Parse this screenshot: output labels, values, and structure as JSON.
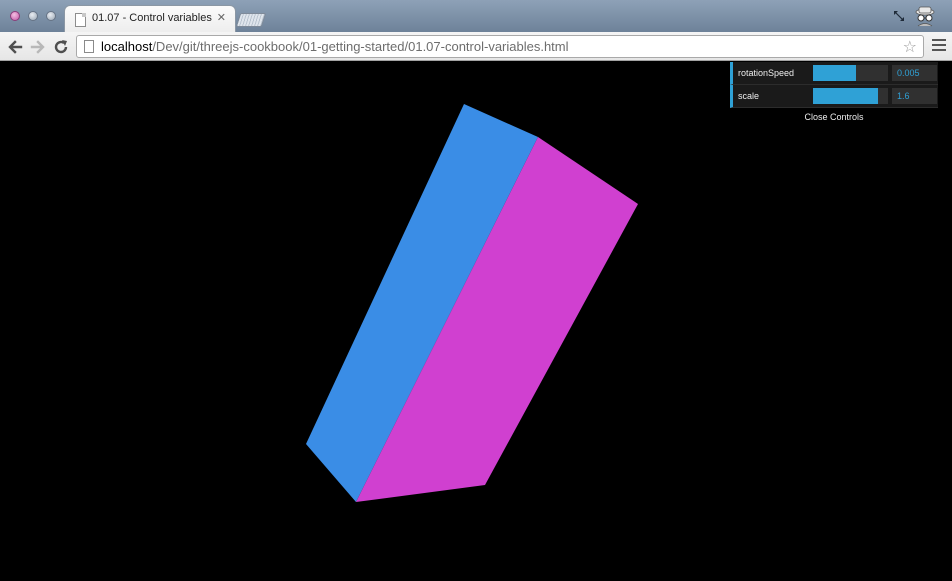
{
  "browser": {
    "tab_title": "01.07 - Control variables",
    "tab_close": "✕",
    "url_host": "localhost",
    "url_path": "/Dev/git/threejs-cookbook/01-getting-started/01.07-control-variables.html",
    "star_icon": "star-icon",
    "back_icon": "back-arrow-icon",
    "forward_icon": "forward-arrow-icon",
    "reload_icon": "reload-icon",
    "menu_icon": "hamburger-menu-icon"
  },
  "scene": {
    "background": "#000000",
    "object": "cube",
    "face_colors": {
      "left": "#3a8de6",
      "right": "#d040d0"
    }
  },
  "controls": {
    "accent": "#2fa1d6",
    "items": [
      {
        "label": "rotationSpeed",
        "value": "0.005",
        "fill_fraction": 0.57
      },
      {
        "label": "scale",
        "value": "1.6",
        "fill_fraction": 0.86
      }
    ],
    "close_label": "Close Controls"
  }
}
